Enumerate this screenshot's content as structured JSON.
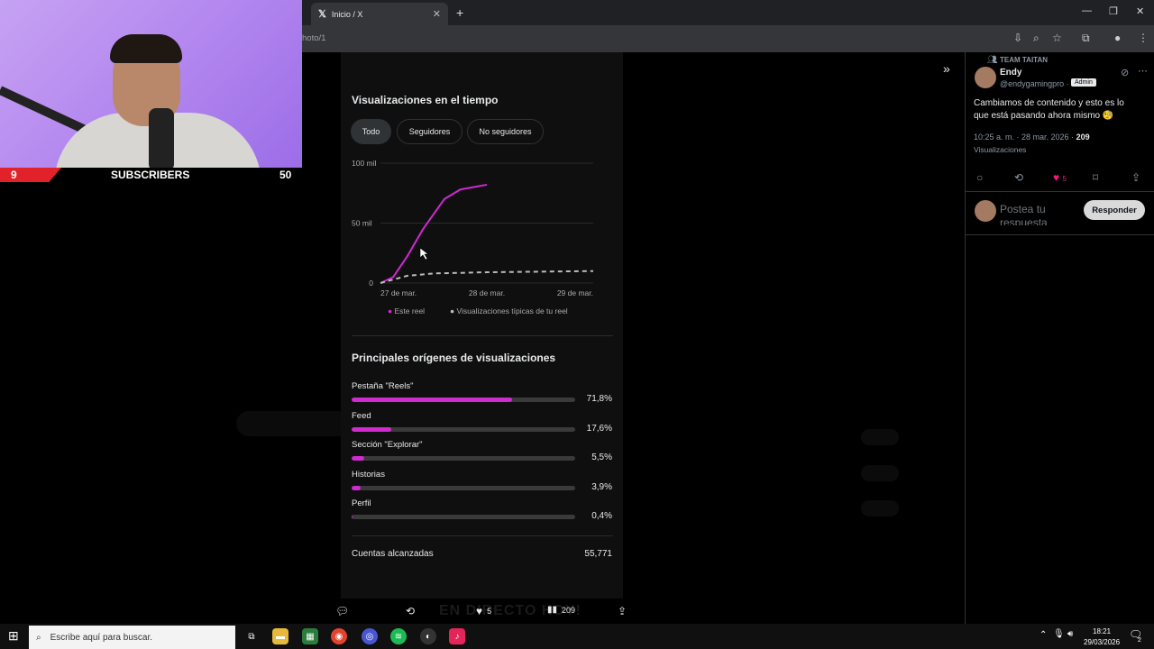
{
  "browser": {
    "tab_title": "Inicio / X",
    "url_fragment": "hoto/1"
  },
  "stream_overlay": {
    "subs_current": "9",
    "subs_label": "SUBSCRIBERS",
    "subs_goal": "50"
  },
  "panel": {
    "chart_title": "Visualizaciones en el tiempo",
    "filters": [
      "Todo",
      "Seguidores",
      "No seguidores"
    ],
    "legend": [
      "Este reel",
      "Visualizaciones típicas de tu reel"
    ],
    "origins_title": "Principales orígenes de visualizaciones",
    "sources": [
      {
        "label": "Pestaña \"Reels\"",
        "pct": "71,8%",
        "value": 71.8
      },
      {
        "label": "Feed",
        "pct": "17,6%",
        "value": 17.6
      },
      {
        "label": "Sección \"Explorar\"",
        "pct": "5,5%",
        "value": 5.5
      },
      {
        "label": "Historias",
        "pct": "3,9%",
        "value": 3.9
      },
      {
        "label": "Perfil",
        "pct": "0,4%",
        "value": 0.4
      }
    ],
    "reach_label": "Cuentas alcanzadas",
    "reach_value": "55,771"
  },
  "chart_data": {
    "type": "line",
    "title": "Visualizaciones en el tiempo",
    "y_ticks": [
      "0",
      "50 mil",
      "100 mil"
    ],
    "x_ticks": [
      "27 de mar.",
      "28 de mar.",
      "29 de mar."
    ],
    "ylim": [
      0,
      100000
    ],
    "grid": true,
    "legend_position": "bottom",
    "series": [
      {
        "name": "Este reel",
        "color": "#d02ad0",
        "style": "solid",
        "x": [
          0,
          0.12,
          0.25,
          0.4,
          0.6,
          0.75,
          1.0
        ],
        "y": [
          0,
          5000,
          22000,
          45000,
          70000,
          78000,
          82000
        ]
      },
      {
        "name": "Visualizaciones típicas de tu reel",
        "color": "#bbbbbb",
        "style": "dashed",
        "x": [
          0,
          0.25,
          0.5,
          1.0,
          1.5,
          2.0
        ],
        "y": [
          0,
          6000,
          8000,
          9000,
          9500,
          10000
        ]
      }
    ]
  },
  "actions": {
    "likes": "5",
    "views": "209"
  },
  "banner_text": "EN DIRECTO HOY!",
  "right_panel": {
    "team": "TEAM TAITAN",
    "name": "Endy",
    "handle": "@endygamingpro ·",
    "badge": "Admin",
    "tweet": "Cambiamos de contenido y esto es lo que está pasando ahora mismo 🧐",
    "meta_time": "10:25 a. m. · 28 mar. 2026 ·",
    "meta_views": "209",
    "views_label": "Visualizaciones",
    "likes": "5",
    "reply_placeholder": "Postea tu respuesta",
    "reply_button": "Responder"
  },
  "taskbar": {
    "search_placeholder": "Escribe aquí para buscar.",
    "time": "18:21",
    "date": "29/03/2026",
    "notifications": "2"
  }
}
